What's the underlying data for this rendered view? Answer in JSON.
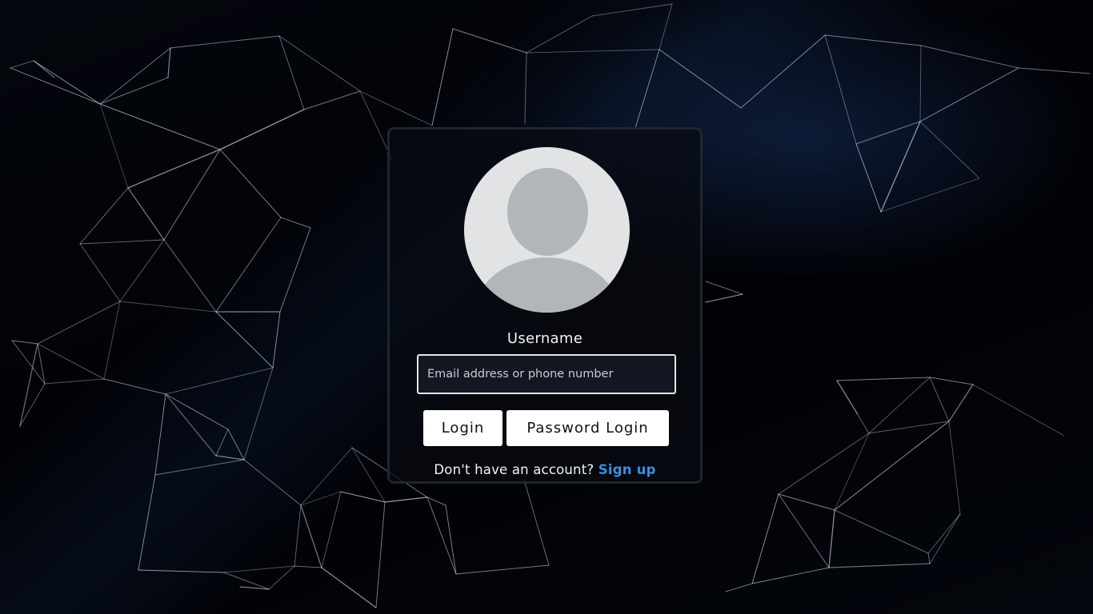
{
  "login": {
    "username_label": "Username",
    "username_input": {
      "value": "",
      "placeholder": "Email address or phone number"
    },
    "login_button_label": "Login",
    "password_login_button_label": "Password Login",
    "signup_prompt": "Don't have an account?",
    "signup_link_label": "Sign up"
  },
  "avatar": {
    "icon": "default-user-avatar-icon"
  },
  "colors": {
    "background": "#020306",
    "card_border": "#1f2530",
    "link": "#3a8fde",
    "button_background": "#ffffff",
    "avatar_background": "#e2e3e5",
    "avatar_silhouette": "#b3b6b9"
  }
}
